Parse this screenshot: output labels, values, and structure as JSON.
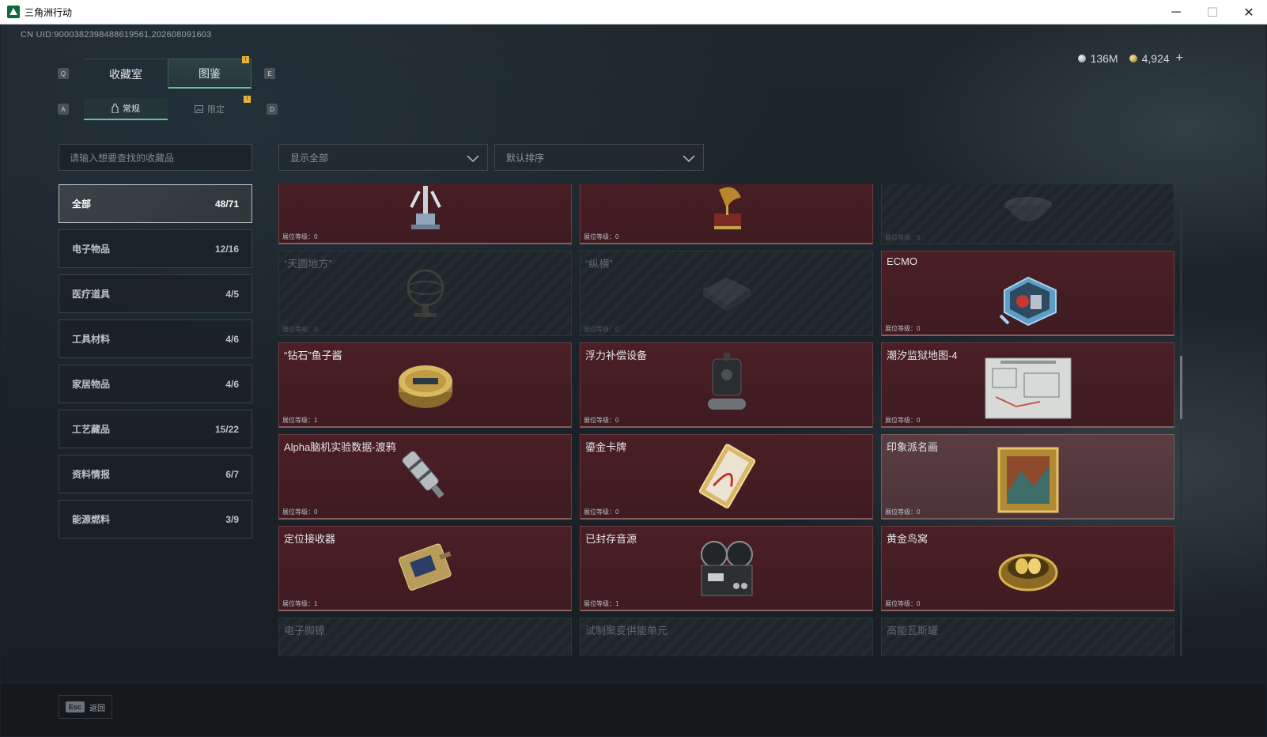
{
  "window": {
    "title": "三角洲行动",
    "controls": [
      "─",
      "☐",
      "✕"
    ]
  },
  "uid": "CN UID:9000382398488619561,202608091603",
  "currency": {
    "silver": "136M",
    "gold": "4,924",
    "add": "+"
  },
  "keyhints": {
    "left_tab": "Q",
    "right_tab": "E",
    "left_sub": "A",
    "right_sub": "D"
  },
  "tabs": [
    {
      "label": "收藏室"
    },
    {
      "label": "图鉴"
    }
  ],
  "subtabs": [
    {
      "label": "常规"
    },
    {
      "label": "限定"
    }
  ],
  "notify_mark": "!",
  "search": {
    "placeholder": "请输入想要查找的收藏品"
  },
  "filters": {
    "show": "显示全部",
    "sort": "默认排序"
  },
  "categories": [
    {
      "label": "全部",
      "count": "48/71"
    },
    {
      "label": "电子物品",
      "count": "12/16"
    },
    {
      "label": "医疗道具",
      "count": "4/5"
    },
    {
      "label": "工具材料",
      "count": "4/6"
    },
    {
      "label": "家居物品",
      "count": "4/6"
    },
    {
      "label": "工艺藏品",
      "count": "15/22"
    },
    {
      "label": "资料情报",
      "count": "6/7"
    },
    {
      "label": "能源燃料",
      "count": "3/9"
    }
  ],
  "level_label": "展位等级：",
  "items": [
    {
      "title": "",
      "level": "0",
      "owned": true,
      "icon": "robot-arm-icon"
    },
    {
      "title": "",
      "level": "0",
      "owned": true,
      "icon": "gramophone-icon"
    },
    {
      "title": "",
      "level": "0",
      "owned": false,
      "icon": "bowl-icon"
    },
    {
      "title": "“天圆地方”",
      "level": "0",
      "owned": false,
      "icon": "armillary-sphere-icon"
    },
    {
      "title": "“纵横”",
      "level": "0",
      "owned": false,
      "icon": "chessboard-icon"
    },
    {
      "title": "ECMO",
      "level": "0",
      "owned": true,
      "icon": "ecmo-machine-icon"
    },
    {
      "title": "“钻石”鱼子酱",
      "level": "1",
      "owned": true,
      "icon": "caviar-tin-icon"
    },
    {
      "title": "浮力补偿设备",
      "level": "0",
      "owned": true,
      "icon": "buoyancy-device-icon"
    },
    {
      "title": "潮汐监狱地图-4",
      "level": "0",
      "owned": true,
      "icon": "map-icon"
    },
    {
      "title": "Alpha脑机实验数据-渡鸦",
      "level": "0",
      "owned": true,
      "icon": "data-canister-icon"
    },
    {
      "title": "鎏金卡牌",
      "level": "0",
      "owned": true,
      "icon": "gold-card-icon"
    },
    {
      "title": "印象派名画",
      "level": "0",
      "owned": true,
      "special": true,
      "icon": "painting-icon"
    },
    {
      "title": "定位接收器",
      "level": "1",
      "owned": true,
      "icon": "gps-receiver-icon"
    },
    {
      "title": "已封存音源",
      "level": "1",
      "owned": true,
      "icon": "reel-recorder-icon"
    },
    {
      "title": "黄金鸟窝",
      "level": "0",
      "owned": true,
      "icon": "golden-nest-icon"
    },
    {
      "title": "电子脚镣",
      "level": "",
      "owned": false,
      "icon": "ankle-monitor-icon"
    },
    {
      "title": "试制聚变供能单元",
      "level": "",
      "owned": false,
      "icon": "fusion-unit-icon"
    },
    {
      "title": "高能瓦斯罐",
      "level": "",
      "owned": false,
      "icon": "gas-tank-icon"
    }
  ],
  "scroll": {
    "position": 0.42
  },
  "footer": {
    "esc_key": "Esc",
    "back_label": "返回"
  },
  "colors": {
    "accent": "#62c29b",
    "owned_card": "#4a1f25",
    "notify": "#e6b33a"
  }
}
